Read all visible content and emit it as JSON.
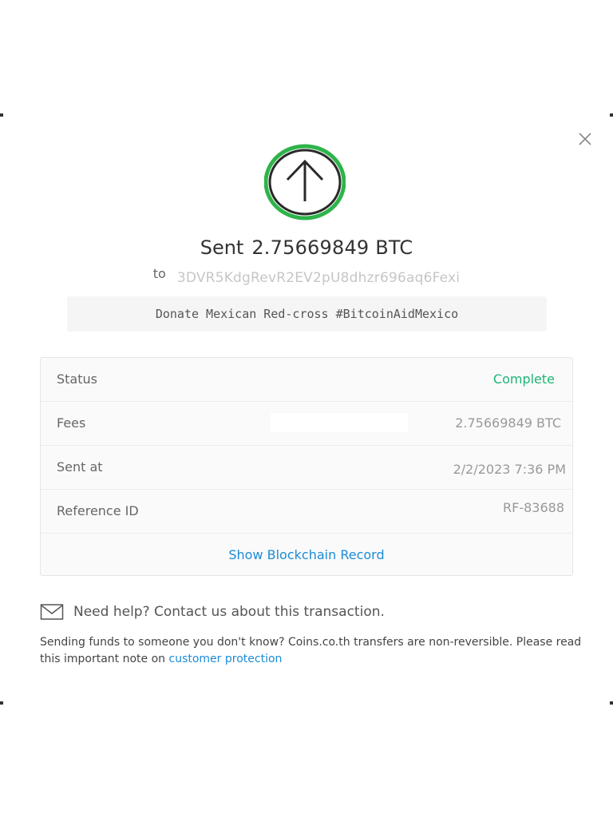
{
  "modal": {
    "direction": "Sent",
    "amount": "2.75669849 BTC",
    "to_label": "to",
    "address": "3DVR5KdgRevR2EV2pU8dhzr696aq6Fexi",
    "memo": "Donate Mexican Red-cross #BitcoinAidMexico",
    "close_icon": "close-icon",
    "status_icon": "arrow-up-icon",
    "status_ring_color": "#2eb44a"
  },
  "details": {
    "status": {
      "label": "Status",
      "value": "Complete",
      "color": "#1db574"
    },
    "fees": {
      "label": "Fees",
      "value": "2.75669849 BTC"
    },
    "sent_at": {
      "label": "Sent at",
      "value": "2/2/2023 7:36 PM"
    },
    "reference": {
      "label": "Reference ID",
      "value": "RF-83688"
    },
    "blockchain_link": "Show Blockchain Record"
  },
  "help": {
    "icon": "envelope-icon",
    "text": "Need help? Contact us about this transaction."
  },
  "disclaimer": {
    "text": "Sending funds to someone you don't know? Coins.co.th transfers are non-reversible. Please read this important note on ",
    "link": "customer protection"
  }
}
